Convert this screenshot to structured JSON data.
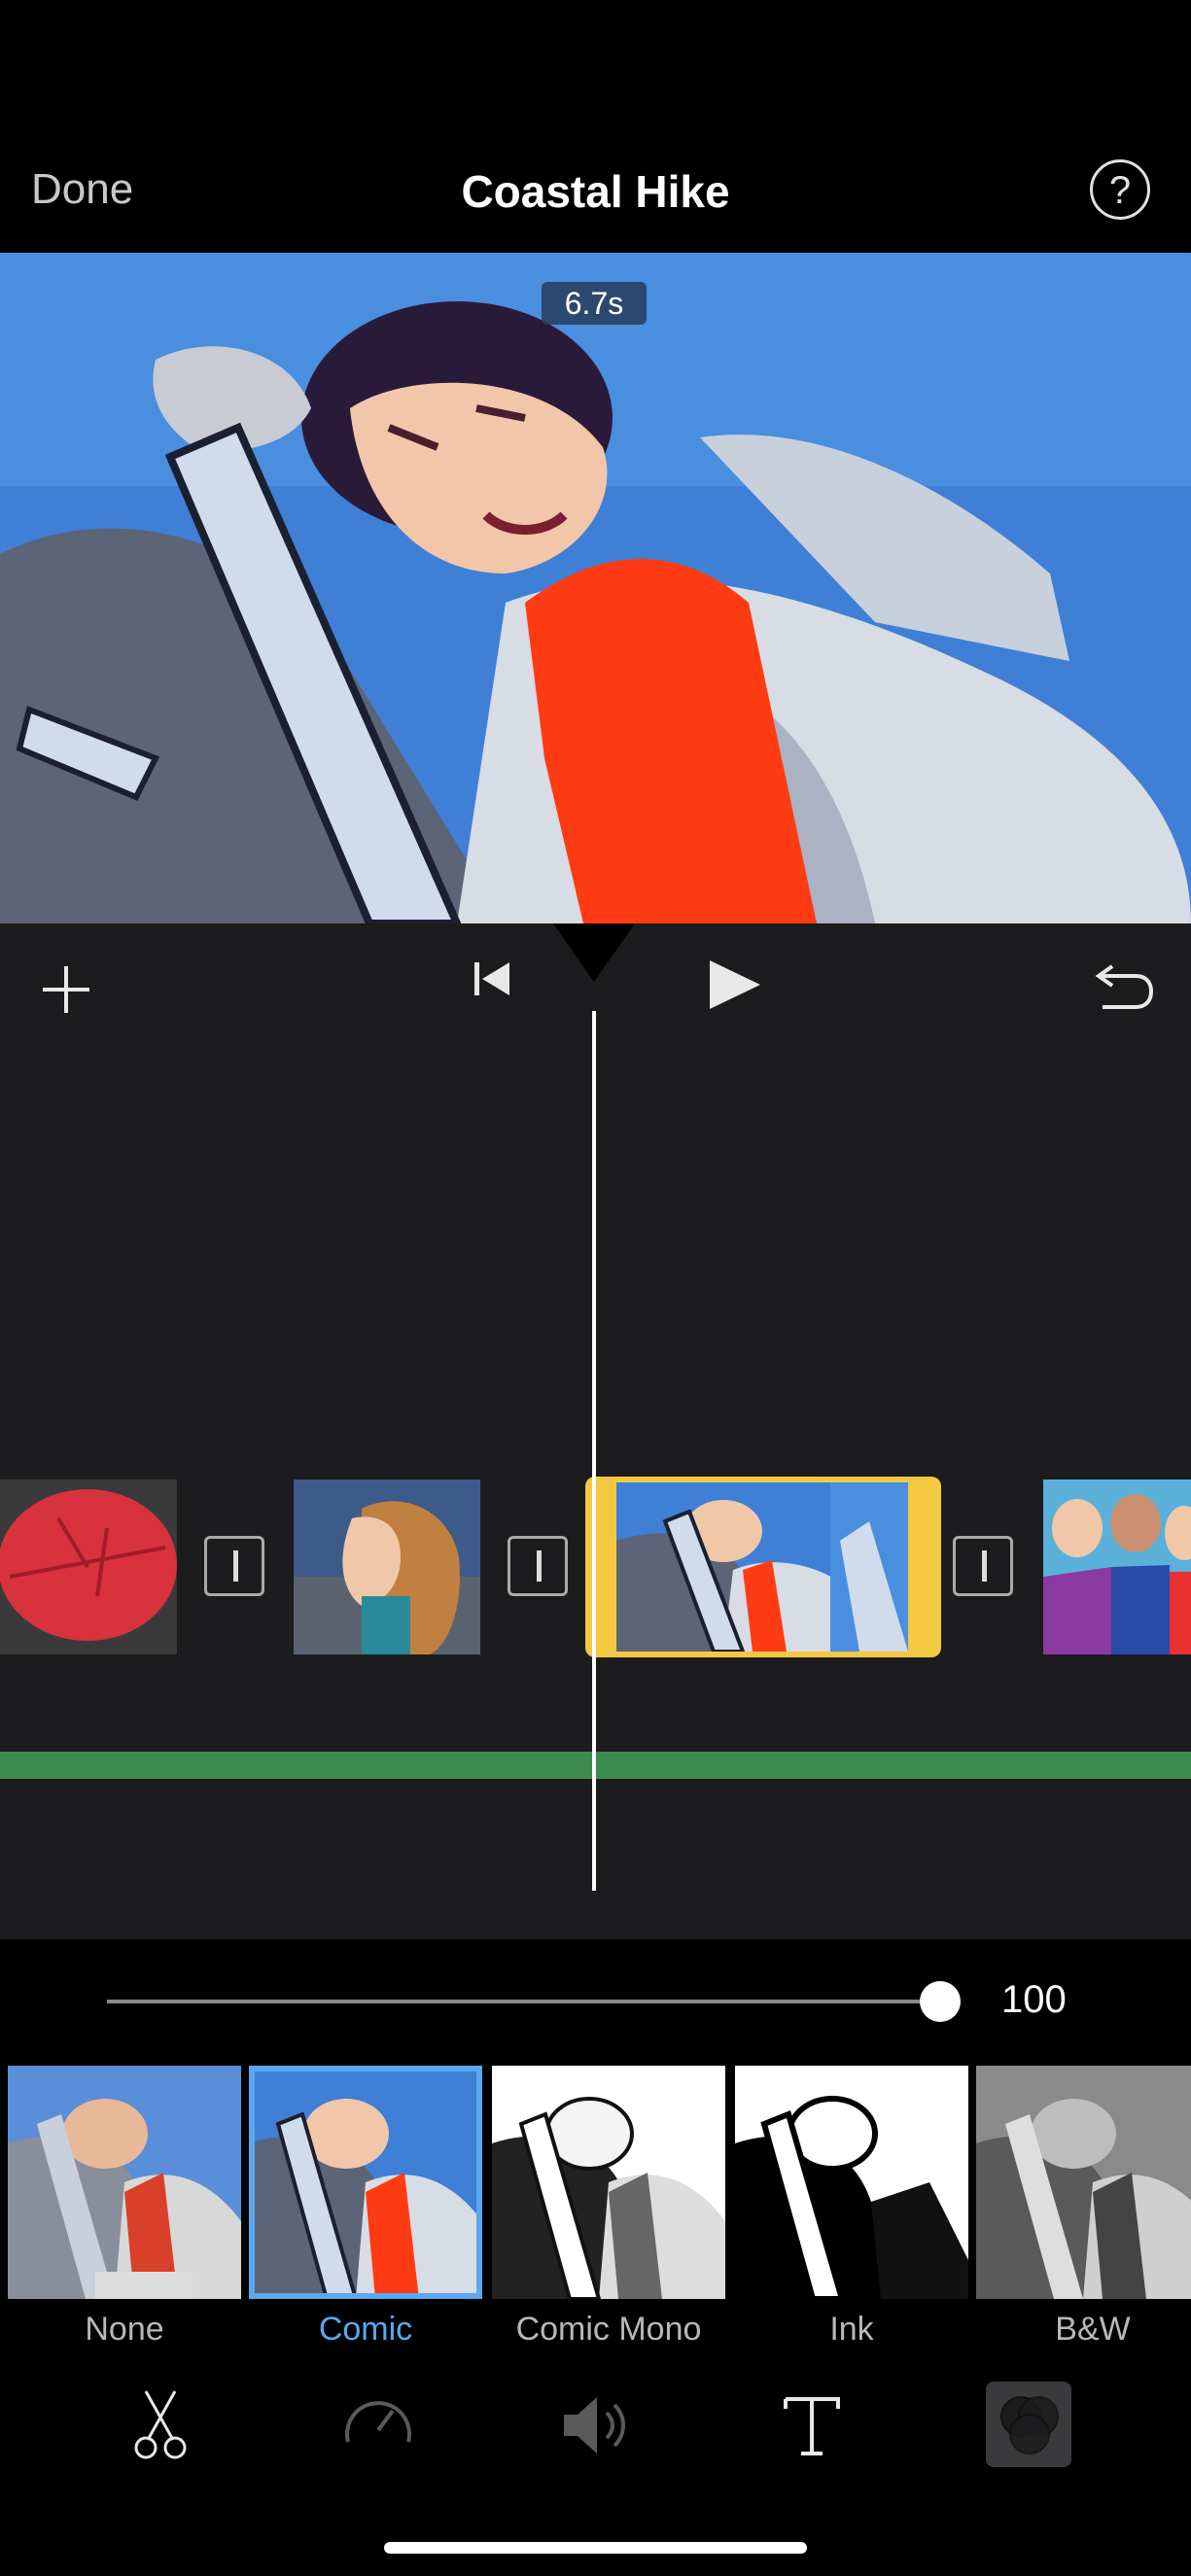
{
  "nav": {
    "done_label": "Done",
    "title": "Coastal Hike",
    "help_label": "?"
  },
  "preview": {
    "time_badge": "6.7s"
  },
  "timeline": {
    "clips": [
      "red-leaf",
      "woman-profile",
      "woman-ladder",
      "group-friends"
    ],
    "selected_clip": "woman-ladder",
    "accent_color": "#f5c842",
    "audio_track_color": "#3d8a4e"
  },
  "slider": {
    "value": "100",
    "level_percent": 100
  },
  "filters": {
    "items": [
      {
        "label": "None"
      },
      {
        "label": "Comic"
      },
      {
        "label": "Comic Mono"
      },
      {
        "label": "Ink"
      },
      {
        "label": "B&W"
      }
    ],
    "selected": "Comic",
    "selected_color": "#5aa8f0"
  },
  "toolbar": {
    "tools": [
      "scissors-icon",
      "speed-icon",
      "volume-icon",
      "text-icon",
      "filters-icon"
    ],
    "active_tool": "filters-icon"
  }
}
